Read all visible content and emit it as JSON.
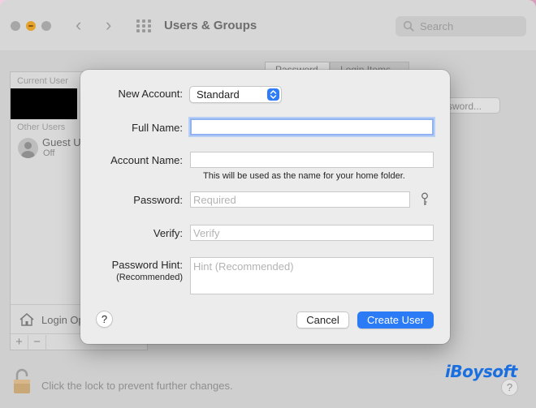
{
  "window": {
    "title": "Users & Groups",
    "search_placeholder": "Search",
    "tabs": [
      "Password",
      "Login Items"
    ],
    "change_password_button": "ssword...",
    "lock_text": "Click the lock to prevent further changes.",
    "help": "?"
  },
  "sidebar": {
    "current_user_heading": "Current User",
    "other_users_heading": "Other Users",
    "guest_name": "Guest U",
    "guest_status": "Off",
    "login_options": "Login Op",
    "add": "+",
    "remove": "−"
  },
  "sheet": {
    "new_account_label": "New Account:",
    "new_account_value": "Standard",
    "full_name_label": "Full Name:",
    "full_name_value": "",
    "account_name_label": "Account Name:",
    "account_name_value": "",
    "account_name_note": "This will be used as the name for your home folder.",
    "password_label": "Password:",
    "password_placeholder": "Required",
    "verify_label": "Verify:",
    "verify_placeholder": "Verify",
    "hint_label": "Password Hint:",
    "hint_sublabel": "(Recommended)",
    "hint_placeholder": "Hint (Recommended)",
    "help": "?",
    "cancel_label": "Cancel",
    "create_label": "Create User"
  },
  "brand": "iBoysoft",
  "colors": {
    "accent": "#2a7bf5",
    "focus_ring": "#8fb3f0",
    "brand": "#1a6fe0"
  }
}
